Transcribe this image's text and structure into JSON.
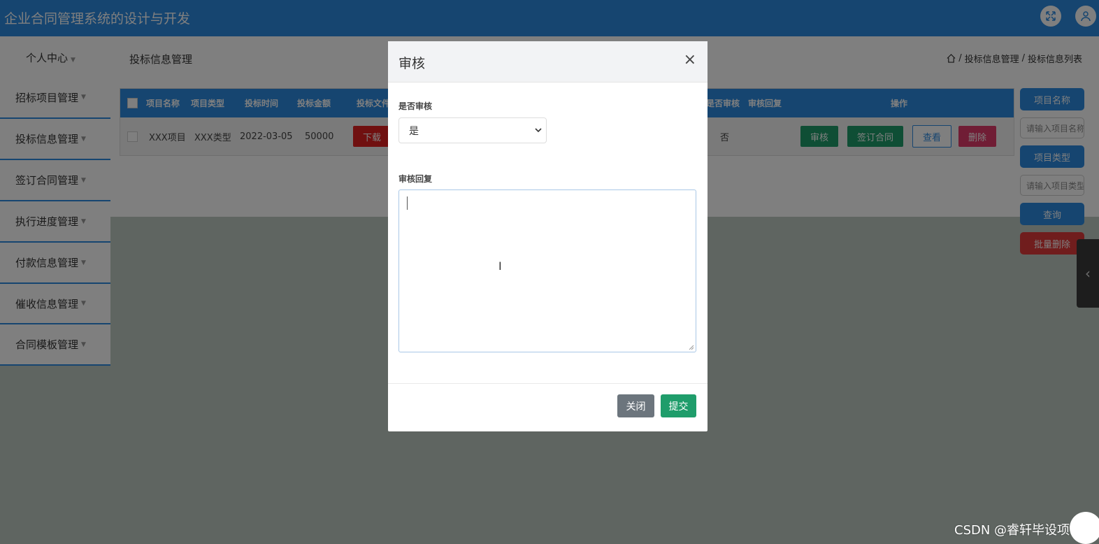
{
  "app": {
    "title": "企业合同管理系统的设计与开发"
  },
  "header": {
    "fullscreen_icon": "expand-icon",
    "user_icon": "user-icon"
  },
  "subbar": {
    "personal_center": "个人中心",
    "page_heading": "投标信息管理",
    "breadcrumb": {
      "home_icon": "home-icon",
      "sep": "/",
      "level1": "投标信息管理",
      "level2": "投标信息列表"
    }
  },
  "sidebar": {
    "items": [
      {
        "label": "招标项目管理"
      },
      {
        "label": "投标信息管理"
      },
      {
        "label": "签订合同管理"
      },
      {
        "label": "执行进度管理"
      },
      {
        "label": "付款信息管理"
      },
      {
        "label": "催收信息管理"
      },
      {
        "label": "合同模板管理"
      }
    ]
  },
  "table": {
    "headers": {
      "name": "项目名称",
      "type": "项目类型",
      "time": "投标时间",
      "amount": "投标金额",
      "file": "投标文件",
      "audited": "是否审核",
      "reply": "审核回复",
      "actions": "操作"
    },
    "row": {
      "name": "XXX项目",
      "type": "XXX类型",
      "time": "2022-03-05",
      "amount": "50000",
      "download": "下载",
      "audited": "否",
      "btn_audit": "审核",
      "btn_sign": "签订合同",
      "btn_view": "查看",
      "btn_delete": "删除"
    }
  },
  "right_panel": {
    "name_label": "项目名称",
    "name_placeholder": "请输入项目名称",
    "type_label": "项目类型",
    "type_placeholder": "请输入项目类型",
    "search": "查询",
    "batch_delete": "批量删除"
  },
  "modal": {
    "title": "审核",
    "close": "×",
    "audit_label": "是否审核",
    "audit_value": "是",
    "reply_label": "审核回复",
    "reply_value": "",
    "btn_close": "关闭",
    "btn_submit": "提交"
  },
  "watermark": "CSDN @睿轩毕设项目",
  "colors": {
    "primary": "#2d8ae0",
    "success": "#1f9d6b",
    "danger": "#e03a3a",
    "secondary": "#6c757d"
  }
}
